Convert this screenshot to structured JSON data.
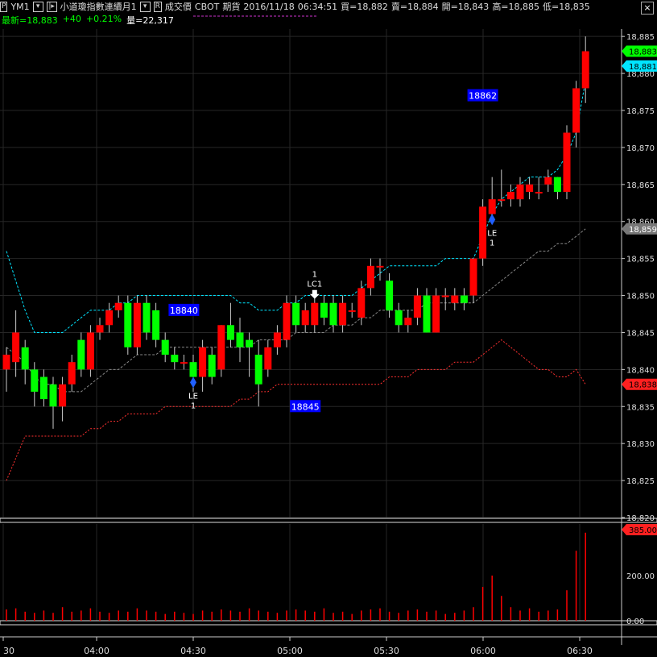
{
  "header": {
    "symbol_box": "P",
    "symbol": "YM1",
    "instrument": "小道瓊指數連續月1",
    "price_type_box": "R",
    "price_type": "成交價",
    "exchange": "CBOT",
    "market": "期貨",
    "date": "2016/11/18",
    "time": "06:34:51",
    "bid": "買=18,882",
    "ask": "賣=18,884",
    "open": "開=18,843",
    "high": "高=18,885",
    "low": "低=18,835",
    "last": "最新=18,883",
    "change": "+40",
    "change_pct": "+0.21%",
    "volume": "量=22,317",
    "close_glyph": "×"
  },
  "colors": {
    "up": "#ff0000",
    "down": "#00ff00",
    "background": "#000000",
    "upper_band": "#00e5ff",
    "lower_band": "#888888",
    "bottom_band": "#ff3030",
    "label_box": "#0000ff"
  },
  "chart_data": {
    "type": "candlestick",
    "price_axis": {
      "ylim": [
        18820,
        18886
      ],
      "ticks": [
        "18,885",
        "18,880",
        "18,875",
        "18,870",
        "18,865",
        "18,860",
        "18,855",
        "18,850",
        "18,845",
        "18,840",
        "18,835",
        "18,830",
        "18,825",
        "18,820"
      ],
      "markers": [
        {
          "label": "18,883",
          "value": 18883,
          "color": "#00ff00"
        },
        {
          "label": "18,881",
          "value": 18881,
          "color": "#00e5ff"
        },
        {
          "label": "18,859",
          "value": 18859,
          "color": "#777777"
        },
        {
          "label": "18,838",
          "value": 18838,
          "color": "#ff2020"
        }
      ]
    },
    "time_axis": [
      "30",
      "04:00",
      "04:30",
      "05:00",
      "05:30",
      "06:00",
      "06:30"
    ],
    "candles": [
      {
        "o": 18840,
        "c": 18842,
        "h": 18843,
        "l": 18837
      },
      {
        "o": 18841,
        "c": 18845,
        "h": 18848,
        "l": 18839
      },
      {
        "o": 18843,
        "c": 18840,
        "h": 18844,
        "l": 18838
      },
      {
        "o": 18840,
        "c": 18837,
        "h": 18841,
        "l": 18835
      },
      {
        "o": 18839,
        "c": 18836,
        "h": 18840,
        "l": 18835
      },
      {
        "o": 18838,
        "c": 18835,
        "h": 18839,
        "l": 18832
      },
      {
        "o": 18835,
        "c": 18838,
        "h": 18839,
        "l": 18833
      },
      {
        "o": 18838,
        "c": 18841,
        "h": 18842,
        "l": 18837
      },
      {
        "o": 18844,
        "c": 18840,
        "h": 18845,
        "l": 18839
      },
      {
        "o": 18840,
        "c": 18845,
        "h": 18846,
        "l": 18839
      },
      {
        "o": 18845,
        "c": 18846,
        "h": 18847,
        "l": 18844
      },
      {
        "o": 18846,
        "c": 18848,
        "h": 18849,
        "l": 18845
      },
      {
        "o": 18848,
        "c": 18849,
        "h": 18850,
        "l": 18847
      },
      {
        "o": 18849,
        "c": 18843,
        "h": 18850,
        "l": 18842
      },
      {
        "o": 18843,
        "c": 18849,
        "h": 18850,
        "l": 18842
      },
      {
        "o": 18849,
        "c": 18845,
        "h": 18850,
        "l": 18844
      },
      {
        "o": 18848,
        "c": 18844,
        "h": 18849,
        "l": 18843
      },
      {
        "o": 18844,
        "c": 18842,
        "h": 18845,
        "l": 18841
      },
      {
        "o": 18842,
        "c": 18841,
        "h": 18843,
        "l": 18840
      },
      {
        "o": 18841,
        "c": 18841,
        "h": 18842,
        "l": 18840
      },
      {
        "o": 18841,
        "c": 18839,
        "h": 18842,
        "l": 18837
      },
      {
        "o": 18839,
        "c": 18843,
        "h": 18844,
        "l": 18837
      },
      {
        "o": 18842,
        "c": 18839,
        "h": 18843,
        "l": 18838
      },
      {
        "o": 18840,
        "c": 18846,
        "h": 18846,
        "l": 18839
      },
      {
        "o": 18846,
        "c": 18844,
        "h": 18849,
        "l": 18843
      },
      {
        "o": 18845,
        "c": 18843,
        "h": 18847,
        "l": 18841
      },
      {
        "o": 18844,
        "c": 18843,
        "h": 18845,
        "l": 18839
      },
      {
        "o": 18842,
        "c": 18838,
        "h": 18844,
        "l": 18835
      },
      {
        "o": 18840,
        "c": 18843,
        "h": 18844,
        "l": 18839
      },
      {
        "o": 18843,
        "c": 18845,
        "h": 18846,
        "l": 18842
      },
      {
        "o": 18844,
        "c": 18849,
        "h": 18850,
        "l": 18843
      },
      {
        "o": 18849,
        "c": 18846,
        "h": 18850,
        "l": 18845
      },
      {
        "o": 18846,
        "c": 18848,
        "h": 18849,
        "l": 18845
      },
      {
        "o": 18846,
        "c": 18849,
        "h": 18850,
        "l": 18845
      },
      {
        "o": 18849,
        "c": 18847,
        "h": 18850,
        "l": 18846
      },
      {
        "o": 18849,
        "c": 18846,
        "h": 18850,
        "l": 18845
      },
      {
        "o": 18846,
        "c": 18849,
        "h": 18850,
        "l": 18845
      },
      {
        "o": 18848,
        "c": 18848,
        "h": 18849,
        "l": 18847
      },
      {
        "o": 18847,
        "c": 18851,
        "h": 18852,
        "l": 18846
      },
      {
        "o": 18851,
        "c": 18854,
        "h": 18855,
        "l": 18850
      },
      {
        "o": 18854,
        "c": 18854,
        "h": 18855,
        "l": 18852
      },
      {
        "o": 18852,
        "c": 18848,
        "h": 18853,
        "l": 18847
      },
      {
        "o": 18848,
        "c": 18846,
        "h": 18849,
        "l": 18845
      },
      {
        "o": 18846,
        "c": 18847,
        "h": 18848,
        "l": 18845
      },
      {
        "o": 18847,
        "c": 18850,
        "h": 18851,
        "l": 18846
      },
      {
        "o": 18850,
        "c": 18845,
        "h": 18851,
        "l": 18845
      },
      {
        "o": 18845,
        "c": 18850,
        "h": 18851,
        "l": 18845
      },
      {
        "o": 18850,
        "c": 18850,
        "h": 18851,
        "l": 18848
      },
      {
        "o": 18849,
        "c": 18850,
        "h": 18851,
        "l": 18848
      },
      {
        "o": 18850,
        "c": 18849,
        "h": 18851,
        "l": 18848
      },
      {
        "o": 18850,
        "c": 18855,
        "h": 18855,
        "l": 18849
      },
      {
        "o": 18855,
        "c": 18862,
        "h": 18863,
        "l": 18854
      },
      {
        "o": 18861,
        "c": 18863,
        "h": 18866,
        "l": 18860
      },
      {
        "o": 18863,
        "c": 18863,
        "h": 18867,
        "l": 18862
      },
      {
        "o": 18863,
        "c": 18864,
        "h": 18865,
        "l": 18862
      },
      {
        "o": 18863,
        "c": 18865,
        "h": 18866,
        "l": 18862
      },
      {
        "o": 18864,
        "c": 18865,
        "h": 18866,
        "l": 18863
      },
      {
        "o": 18864,
        "c": 18864,
        "h": 18866,
        "l": 18863
      },
      {
        "o": 18865,
        "c": 18866,
        "h": 18867,
        "l": 18864
      },
      {
        "o": 18866,
        "c": 18864,
        "h": 18866,
        "l": 18863
      },
      {
        "o": 18864,
        "c": 18872,
        "h": 18873,
        "l": 18863
      },
      {
        "o": 18872,
        "c": 18878,
        "h": 18879,
        "l": 18870
      },
      {
        "o": 18878,
        "c": 18883,
        "h": 18885,
        "l": 18876
      }
    ],
    "upper_band": [
      18856,
      18852,
      18848,
      18845,
      18845,
      18845,
      18845,
      18846,
      18847,
      18848,
      18848,
      18848,
      18849,
      18849,
      18850,
      18850,
      18850,
      18850,
      18850,
      18850,
      18850,
      18850,
      18850,
      18850,
      18850,
      18849,
      18849,
      18848,
      18848,
      18848,
      18849,
      18849,
      18850,
      18850,
      18850,
      18850,
      18850,
      18850,
      18851,
      18852,
      18853,
      18854,
      18854,
      18854,
      18854,
      18854,
      18854,
      18855,
      18855,
      18855,
      18855,
      18858,
      18861,
      18863,
      18864,
      18865,
      18866,
      18866,
      18866,
      18867,
      18869,
      18872,
      18879
    ],
    "lower_band": [
      18843,
      18842,
      18841,
      18839,
      18838,
      18838,
      18837,
      18837,
      18837,
      18838,
      18839,
      18840,
      18840,
      18841,
      18842,
      18842,
      18842,
      18843,
      18843,
      18843,
      18843,
      18843,
      18843,
      18843,
      18843,
      18843,
      18843,
      18844,
      18844,
      18844,
      18844,
      18845,
      18845,
      18845,
      18845,
      18846,
      18846,
      18846,
      18847,
      18847,
      18848,
      18848,
      18848,
      18848,
      18848,
      18849,
      18849,
      18849,
      18849,
      18849,
      18849,
      18850,
      18851,
      18852,
      18853,
      18854,
      18855,
      18856,
      18856,
      18857,
      18857,
      18858,
      18859
    ],
    "bottom_band": [
      18825,
      18828,
      18831,
      18831,
      18831,
      18831,
      18831,
      18831,
      18831,
      18832,
      18832,
      18833,
      18833,
      18834,
      18834,
      18834,
      18834,
      18835,
      18835,
      18835,
      18835,
      18835,
      18835,
      18835,
      18835,
      18836,
      18836,
      18837,
      18837,
      18838,
      18838,
      18838,
      18838,
      18838,
      18838,
      18838,
      18838,
      18838,
      18838,
      18838,
      18838,
      18839,
      18839,
      18839,
      18840,
      18840,
      18840,
      18840,
      18841,
      18841,
      18841,
      18842,
      18843,
      18844,
      18843,
      18842,
      18841,
      18840,
      18840,
      18839,
      18839,
      18840,
      18838
    ],
    "volume": {
      "ticks": [
        "0.00",
        "200.00"
      ],
      "marker": "385.00",
      "ylim": [
        0,
        400
      ],
      "values": [
        50,
        55,
        40,
        35,
        45,
        35,
        60,
        40,
        45,
        55,
        40,
        35,
        45,
        40,
        55,
        45,
        40,
        30,
        40,
        35,
        30,
        45,
        40,
        50,
        45,
        40,
        55,
        45,
        40,
        35,
        45,
        50,
        45,
        40,
        55,
        35,
        40,
        30,
        45,
        50,
        55,
        40,
        35,
        45,
        50,
        40,
        45,
        30,
        35,
        45,
        60,
        150,
        200,
        110,
        60,
        45,
        55,
        40,
        45,
        50,
        135,
        310,
        390
      ]
    },
    "price_labels": [
      {
        "text": "18840",
        "value": 18848,
        "index": 19
      },
      {
        "text": "18845",
        "value": 18835,
        "index": 32
      },
      {
        "text": "18862",
        "value": 18877,
        "index": 51
      }
    ],
    "signals": [
      {
        "text": "LE",
        "sub": "1",
        "index": 20,
        "value": 18840,
        "type": "entry"
      },
      {
        "text": "LC1",
        "sub": "1",
        "index": 33,
        "value": 18849,
        "type": "exit"
      },
      {
        "text": "LE",
        "sub": "1",
        "index": 52,
        "value": 18862,
        "type": "entry"
      }
    ]
  }
}
